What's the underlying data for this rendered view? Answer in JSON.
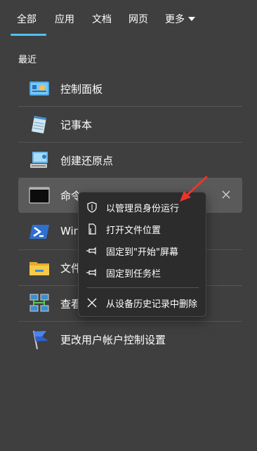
{
  "tabs": [
    {
      "label": "全部",
      "selected": true
    },
    {
      "label": "应用"
    },
    {
      "label": "文档"
    },
    {
      "label": "网页"
    },
    {
      "label": "更多"
    }
  ],
  "recent": {
    "title": "最近",
    "items": [
      {
        "label": "控制面板",
        "icon": "control-panel-icon"
      },
      {
        "label": "记事本",
        "icon": "notepad-icon"
      },
      {
        "label": "创建还原点",
        "icon": "system-restore-icon"
      },
      {
        "label": "命令",
        "icon": "command-prompt-icon",
        "selected": true
      },
      {
        "label": "Win",
        "icon": "powershell-icon"
      },
      {
        "label": "文件",
        "icon": "folder-icon"
      },
      {
        "label": "查看",
        "icon": "network-icon"
      },
      {
        "label": "更改用户帐户控制设置",
        "icon": "uac-flag-icon"
      }
    ]
  },
  "context_menu": {
    "items": [
      {
        "label": "以管理员身份运行",
        "icon": "admin-shield-icon"
      },
      {
        "label": "打开文件位置",
        "icon": "file-location-icon"
      },
      {
        "label": "固定到\"开始\"屏幕",
        "icon": "pin-icon"
      },
      {
        "label": "固定到任务栏",
        "icon": "pin-icon"
      },
      {
        "label": "从设备历史记录中删除",
        "icon": "close-icon"
      }
    ]
  },
  "colors": {
    "accent": "#4cc2ff",
    "background": "#3f3f3f",
    "menu": "#2c2c2c",
    "annotation_arrow": "#e8362c"
  }
}
